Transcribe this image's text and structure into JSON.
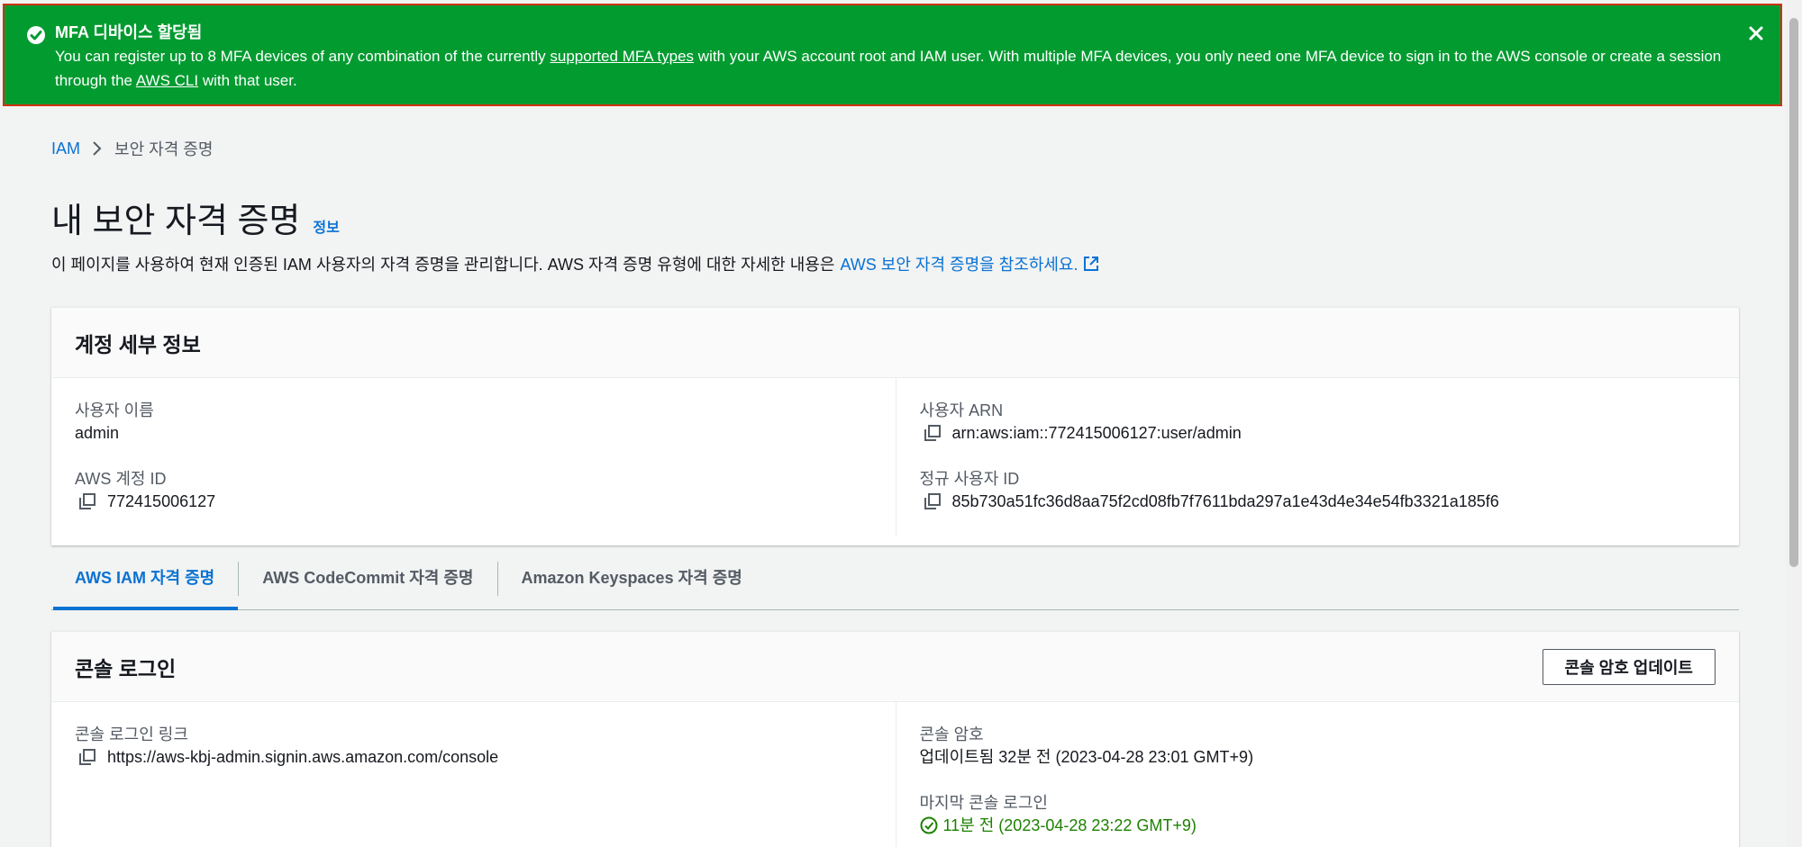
{
  "flash": {
    "title": "MFA 디바이스 할당됨",
    "msg_part1": "You can register up to 8 MFA devices of any combination of the currently ",
    "link1": "supported MFA types",
    "msg_part2": " with your AWS account root and IAM user. With multiple MFA devices, you only need one MFA device to sign in to the AWS console or create a session through the ",
    "link2": "AWS CLI",
    "msg_part3": " with that user.",
    "bg_color": "#029b30"
  },
  "breadcrumb": {
    "root": "IAM",
    "current": "보안 자격 증명"
  },
  "page": {
    "title": "내 보안 자격 증명",
    "info": "정보",
    "desc": "이 페이지를 사용하여 현재 인증된 IAM 사용자의 자격 증명을 관리합니다. AWS 자격 증명 유형에 대한 자세한 내용은",
    "desc_link": "AWS 보안 자격 증명을 참조하세요."
  },
  "account": {
    "title": "계정 세부 정보",
    "username_label": "사용자 이름",
    "username": "admin",
    "account_id_label": "AWS 계정 ID",
    "account_id": "772415006127",
    "arn_label": "사용자 ARN",
    "arn": "arn:aws:iam::772415006127:user/admin",
    "canonical_label": "정규 사용자 ID",
    "canonical": "85b730a51fc36d8aa75f2cd08fb7f7611bda297a1e43d4e34e54fb3321a185f6"
  },
  "tabs": [
    {
      "label": "AWS IAM 자격 증명",
      "active": true
    },
    {
      "label": "AWS CodeCommit 자격 증명",
      "active": false
    },
    {
      "label": "Amazon Keyspaces 자격 증명",
      "active": false
    }
  ],
  "console": {
    "title": "콘솔 로그인",
    "update_button": "콘솔 암호 업데이트",
    "link_label": "콘솔 로그인 링크",
    "link": "https://aws-kbj-admin.signin.aws.amazon.com/console",
    "password_label": "콘솔 암호",
    "password_value": "업데이트됨 32분 전 (2023-04-28 23:01 GMT+9)",
    "last_login_label": "마지막 콘솔 로그인",
    "last_login_value": "11분 전 (2023-04-28 23:22 GMT+9)"
  }
}
